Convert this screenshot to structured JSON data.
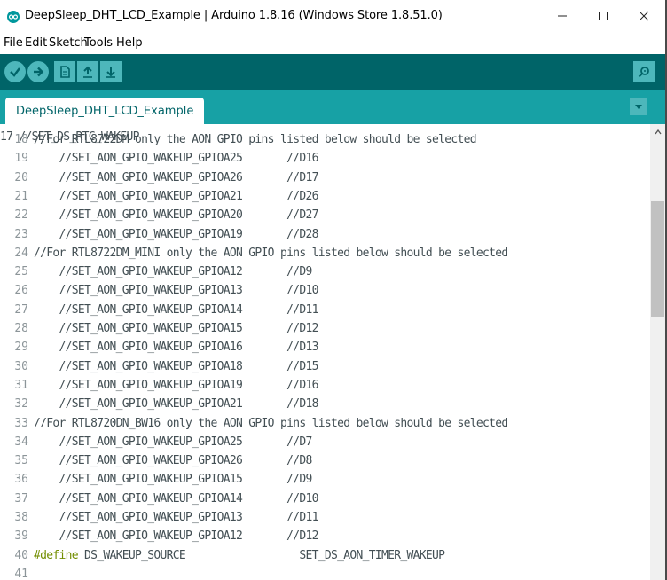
{
  "window": {
    "title": "DeepSleep_DHT_LCD_Example | Arduino 1.8.16 (Windows Store 1.8.51.0)",
    "minimize_icon": "minimize-icon",
    "maximize_icon": "maximize-icon",
    "close_icon": "close-icon"
  },
  "menu": {
    "file": "File",
    "edit": "Edit",
    "sketch": "Sketch",
    "tools": "Tools",
    "help": "Help"
  },
  "toolbar": {
    "buttons": [
      "verify-icon",
      "upload-icon",
      "new-icon",
      "open-icon",
      "save-icon"
    ],
    "serial_monitor_icon": "magnifier-icon",
    "colors": {
      "toolbar_bg": "#006468",
      "tabbar_bg": "#17a1a5",
      "button": "#4db7bb"
    }
  },
  "tabs": {
    "active": "DeepSleep_DHT_LCD_Example"
  },
  "editor": {
    "partial_top_line": "17 //SET_DS_RTC_WAKEUP",
    "lines": [
      {
        "n": "18",
        "text": "//For RTL8722DM only the AON GPIO pins listed below should be selected"
      },
      {
        "n": "19",
        "text": "    //SET_AON_GPIO_WAKEUP_GPIOA25       //D16"
      },
      {
        "n": "20",
        "text": "    //SET_AON_GPIO_WAKEUP_GPIOA26       //D17"
      },
      {
        "n": "21",
        "text": "    //SET_AON_GPIO_WAKEUP_GPIOA21       //D26"
      },
      {
        "n": "22",
        "text": "    //SET_AON_GPIO_WAKEUP_GPIOA20       //D27"
      },
      {
        "n": "23",
        "text": "    //SET_AON_GPIO_WAKEUP_GPIOA19       //D28"
      },
      {
        "n": "24",
        "text": "//For RTL8722DM_MINI only the AON GPIO pins listed below should be selected"
      },
      {
        "n": "25",
        "text": "    //SET_AON_GPIO_WAKEUP_GPIOA12       //D9"
      },
      {
        "n": "26",
        "text": "    //SET_AON_GPIO_WAKEUP_GPIOA13       //D10"
      },
      {
        "n": "27",
        "text": "    //SET_AON_GPIO_WAKEUP_GPIOA14       //D11"
      },
      {
        "n": "28",
        "text": "    //SET_AON_GPIO_WAKEUP_GPIOA15       //D12"
      },
      {
        "n": "29",
        "text": "    //SET_AON_GPIO_WAKEUP_GPIOA16       //D13"
      },
      {
        "n": "30",
        "text": "    //SET_AON_GPIO_WAKEUP_GPIOA18       //D15"
      },
      {
        "n": "31",
        "text": "    //SET_AON_GPIO_WAKEUP_GPIOA19       //D16"
      },
      {
        "n": "32",
        "text": "    //SET_AON_GPIO_WAKEUP_GPIOA21       //D18"
      },
      {
        "n": "33",
        "text": "//For RTL8720DN_BW16 only the AON GPIO pins listed below should be selected"
      },
      {
        "n": "34",
        "text": "    //SET_AON_GPIO_WAKEUP_GPIOA25       //D7"
      },
      {
        "n": "35",
        "text": "    //SET_AON_GPIO_WAKEUP_GPIOA26       //D8"
      },
      {
        "n": "36",
        "text": "    //SET_AON_GPIO_WAKEUP_GPIOA15       //D9"
      },
      {
        "n": "37",
        "text": "    //SET_AON_GPIO_WAKEUP_GPIOA14       //D10"
      },
      {
        "n": "38",
        "text": "    //SET_AON_GPIO_WAKEUP_GPIOA13       //D11"
      },
      {
        "n": "39",
        "text": "    //SET_AON_GPIO_WAKEUP_GPIOA12       //D12"
      },
      {
        "n": "40",
        "keyword": "#define",
        "text": " DS_WAKEUP_SOURCE                  SET_DS_AON_TIMER_WAKEUP"
      },
      {
        "n": "41",
        "text": ""
      }
    ],
    "colors": {
      "code": "#434f54",
      "line_number": "#8c9599",
      "keyword": "#728e00"
    }
  },
  "scrollbar": {
    "position_fraction": 0.25
  }
}
